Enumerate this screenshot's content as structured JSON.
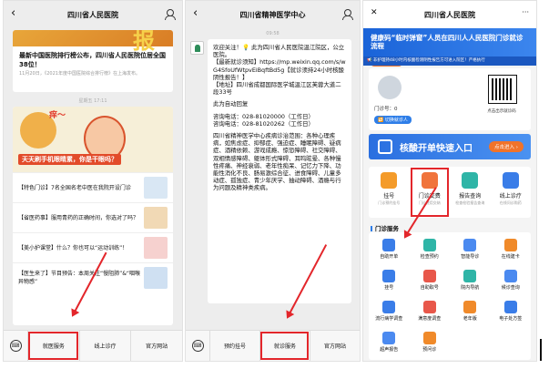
{
  "panel1": {
    "title": "四川省人民医院",
    "back_glyph": "‹",
    "banner_glyph": "报",
    "news_title": "最新中国医院排行榜公布，四川省人民医院位居全国38位！",
    "news_meta": "11月20日，《2021年度中国医院综合排行榜》在上海发布。",
    "time": "星期五 17:11",
    "illus_title": "痒～",
    "illus_caption": "天天刷手机眼睛累，你是干眼吗？",
    "articles": [
      {
        "text": "【特色门诊】7名全国名老中医在我院开设门诊"
      },
      {
        "text": "【省医药事】服用青药的正确时间，你选对了吗？"
      },
      {
        "text": "【美小护课堂】什么？你也可以“运动训练”！"
      },
      {
        "text": "【医生来了】节目预告：本周关注“慢阻肺”&“咽喉异物感”"
      }
    ],
    "tabs": [
      "就医服务",
      "线上诊疗",
      "官方网站"
    ],
    "keyboard_glyph": "⌨"
  },
  "panel2": {
    "title": "四川省精神医学中心",
    "back_glyph": "‹",
    "time": "09:58",
    "lines": [
      "欢迎关注！💡 此为四川省人民医院温江院区，公立医院。",
      "【最新就诊须知】https://mp.weixin.qq.com/s/wG4SfoUfWtpvEiBqftBd5g【就诊须持24小时核酸阴性报告！】",
      "【地址】四川省成都国际医学城温江区芙蓉大道二段33号",
      "此为自动回复",
      "咨询电话：028-81020000（工作日）",
      "咨询电话：028-81020262（工作日）",
      "四川省精神医学中心疾病诊治范围：各种心理疾病，如焦虑症、抑郁症、强迫症、睡眠障碍、疑病症、酒精依赖、游戏成瘾、惊恐障碍、社交障碍、双相情感障碍、躯体形式障碍、耳鸣眩晕、各种慢性疼痛、神经衰弱、老年性痴呆、记忆力下降、功能性消化不良、肠易激综合征、进食障碍、儿童多动症、孤独症、青少年厌学、抽动障碍、酒瘾与行为问题及精神类疾病。"
    ],
    "tabs": [
      "预约挂号",
      "就诊服务",
      "官方网站"
    ],
    "keyboard_glyph": "⌨"
  },
  "panel3": {
    "title": "四川省人民医院",
    "close_glyph": "✕",
    "more_glyph": "···",
    "hero_title": "健康码“临时弹窗”人员在四川人人民医院门诊就诊流程",
    "hero_tag": "点击了解详情",
    "tip": "📢 非护理持48小时内核酸检测阴性报告方可进入院区！严格执行",
    "patient_id": "门诊号：0",
    "switch_label": "🔁 切换就诊人",
    "qr_caption": "点击出示就诊码",
    "nat_title": "核酸开单快速入口",
    "nat_button": "点击进入 ›",
    "quick": [
      {
        "label": "挂号",
        "sub": "门诊预约挂号",
        "color": "#f49b2a"
      },
      {
        "label": "门诊交费",
        "sub": "门诊费用交纳",
        "color": "#f0743c"
      },
      {
        "label": "报告查询",
        "sub": "检查检验报告查询",
        "color": "#2fb5a7"
      },
      {
        "label": "线上诊疗",
        "sub": "在线问诊购药",
        "color": "#3a7de8"
      }
    ],
    "section_title": "门诊服务",
    "services": [
      {
        "label": "自助开单",
        "color": "#3a7de8"
      },
      {
        "label": "检查预约",
        "color": "#2fb5a7"
      },
      {
        "label": "智能导诊",
        "color": "#4b8af0"
      },
      {
        "label": "在线建卡",
        "color": "#f08a2a"
      },
      {
        "label": "挂号",
        "color": "#3a7de8"
      },
      {
        "label": "自助取号",
        "color": "#e8574a"
      },
      {
        "label": "院内导航",
        "color": "#2fb5a7"
      },
      {
        "label": "候诊查询",
        "color": "#4b8af0"
      },
      {
        "label": "流行病学调查",
        "color": "#3a7de8"
      },
      {
        "label": "满意度调查",
        "color": "#e8574a"
      },
      {
        "label": "老年版",
        "color": "#f08a2a"
      },
      {
        "label": "电子处方签",
        "color": "#3a7de8"
      },
      {
        "label": "超声报告",
        "color": "#4b8af0"
      },
      {
        "label": "预问诊",
        "color": "#f08a2a"
      }
    ]
  },
  "colors": {
    "highlight": "#e3262b",
    "blue": "#2260c4",
    "primary": "#2e7ee8"
  }
}
